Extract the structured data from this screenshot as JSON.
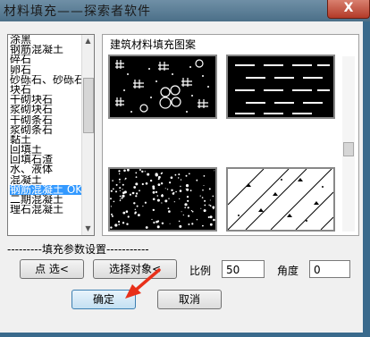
{
  "window": {
    "title": "材料填充——探索者软件",
    "close_label": "X"
  },
  "material_list": {
    "items": [
      "涂黑",
      "钢筋混凝土",
      "碎石",
      "卵石",
      "砂砾石、砂砾石",
      "块石",
      "干砌块石",
      "浆砌块石",
      "干砌条石",
      "浆砌条石",
      "黏土",
      "回填土",
      "回填石渣",
      "水、液体",
      "混凝土",
      "钢筋混凝土 OK",
      "二期混凝土",
      "理石混凝土"
    ],
    "selected": "钢筋混凝土 OK"
  },
  "preview": {
    "title": "建筑材料填充图案",
    "patterns": [
      "cobble-pattern-icon",
      "dashes-pattern-icon",
      "speckle-pattern-icon",
      "diagonal-pattern-icon"
    ]
  },
  "params": {
    "section_title": "---------填充参数设置-----------",
    "point_select_label": "点  选<",
    "select_object_label": "选择对象<",
    "scale_label": "比例",
    "scale_value": "50",
    "angle_label": "角度",
    "angle_value": "0"
  },
  "actions": {
    "ok_label": "确定",
    "cancel_label": "取消"
  },
  "colors": {
    "title_bar": "#4b6f88",
    "selection": "#3399ff",
    "annotation_arrow": "#e8301a"
  }
}
